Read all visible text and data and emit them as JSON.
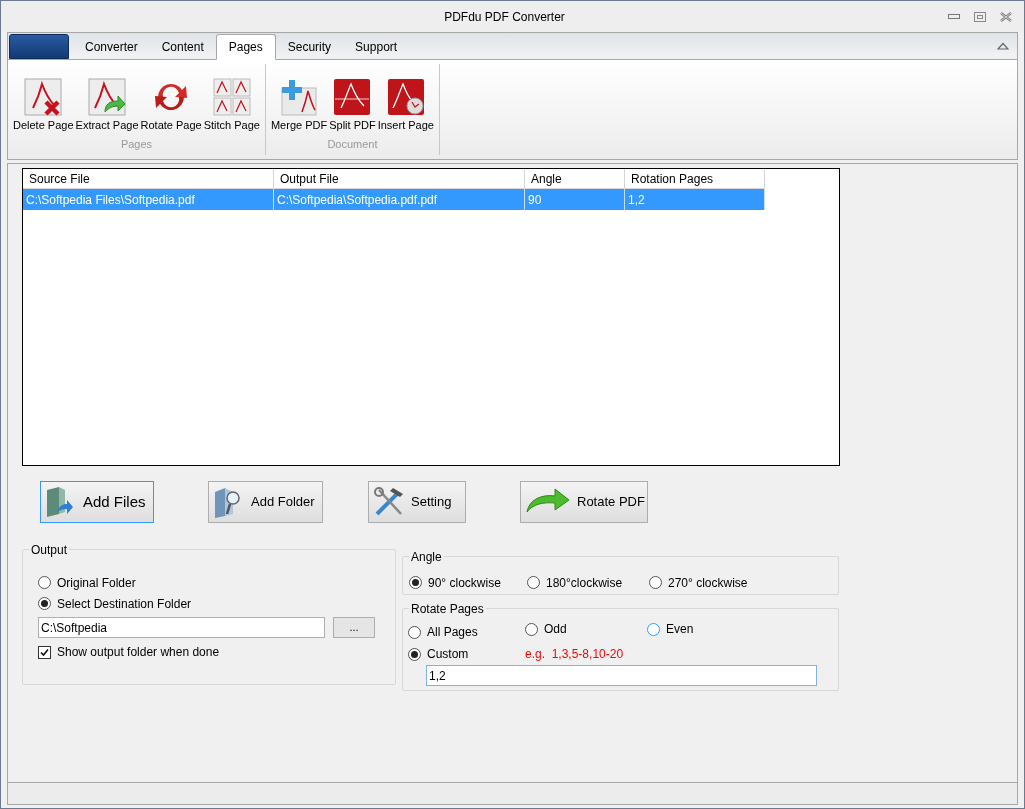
{
  "window": {
    "title": "PDFdu PDF Converter"
  },
  "ribbon": {
    "tabs": [
      {
        "label": "Converter",
        "selected": false
      },
      {
        "label": "Content",
        "selected": false
      },
      {
        "label": "Pages",
        "selected": true
      },
      {
        "label": "Security",
        "selected": false
      },
      {
        "label": "Support",
        "selected": false
      }
    ],
    "groups": [
      {
        "label": "Pages",
        "buttons": [
          {
            "label": "Delete Page",
            "kind": "delete"
          },
          {
            "label": "Extract Page",
            "kind": "extract"
          },
          {
            "label": "Rotate Page",
            "kind": "rotate"
          },
          {
            "label": "Stitch Page",
            "kind": "stitch"
          }
        ]
      },
      {
        "label": "Document",
        "buttons": [
          {
            "label": "Merge PDF",
            "kind": "merge"
          },
          {
            "label": "Split PDF",
            "kind": "split"
          },
          {
            "label": "Insert Page",
            "kind": "insert"
          }
        ]
      }
    ]
  },
  "table": {
    "columns": [
      "Source File",
      "Output File",
      "Angle",
      "Rotation Pages"
    ],
    "rows": [
      {
        "cells": [
          "C:\\Softpedia Files\\Softpedia.pdf",
          "C:\\Softpedia\\Softpedia.pdf.pdf",
          "90",
          "1,2"
        ],
        "selected": true
      }
    ]
  },
  "actions": [
    {
      "label": "Add Files",
      "kind": "add-files",
      "focused": true
    },
    {
      "label": "Add Folder",
      "kind": "add-folder",
      "focused": false
    },
    {
      "label": "Setting",
      "kind": "setting",
      "focused": false
    },
    {
      "label": "Rotate PDF",
      "kind": "rotate-pdf",
      "focused": false
    }
  ],
  "output": {
    "title": "Output",
    "options": [
      {
        "label": "Original Folder",
        "selected": false
      },
      {
        "label": "Select Destination Folder",
        "selected": true
      }
    ],
    "folder_field": {
      "value": "C:\\Softpedia"
    },
    "browse_button": "...",
    "show_when_done": {
      "label": "Show output folder when done",
      "checked": true
    }
  },
  "angle": {
    "title": "Angle",
    "options": [
      {
        "label": "90° clockwise",
        "selected": true
      },
      {
        "label": "180°clockwise",
        "selected": false
      },
      {
        "label": "270° clockwise",
        "selected": false
      }
    ]
  },
  "rotate_pages": {
    "title": "Rotate Pages",
    "options": [
      {
        "label": "All Pages",
        "selected": false
      },
      {
        "label": "Odd",
        "selected": false
      },
      {
        "label": "Even",
        "selected": false
      },
      {
        "label": "Custom",
        "selected": true
      }
    ],
    "hint": "e.g.  1,3,5-8,10-20",
    "custom_field": {
      "value": "1,2"
    }
  }
}
